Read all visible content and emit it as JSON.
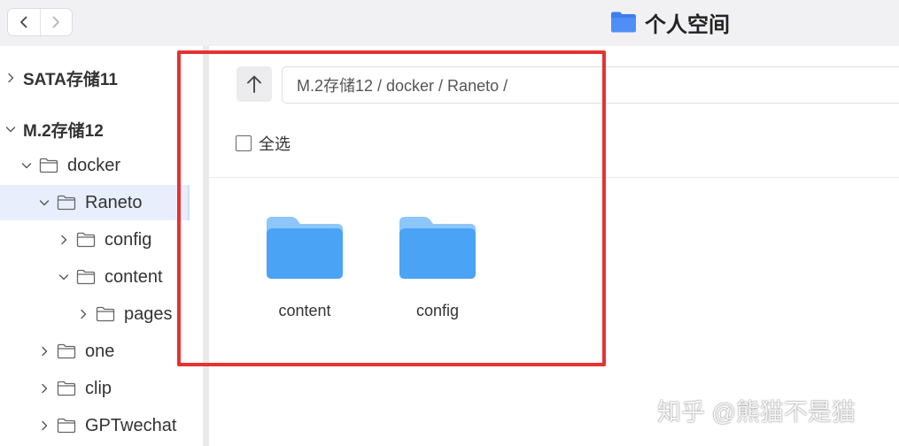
{
  "header": {
    "title": "个人空间",
    "back_icon": "chevron-left-icon",
    "forward_icon": "chevron-right-icon"
  },
  "sidebar": {
    "items": [
      {
        "label": "SATA存储11",
        "expanded": false
      },
      {
        "label": "M.2存储12",
        "expanded": true
      },
      {
        "label": "docker",
        "expanded": true
      },
      {
        "label": "Raneto",
        "expanded": true,
        "selected": true
      },
      {
        "label": "config",
        "expanded": false
      },
      {
        "label": "content",
        "expanded": true
      },
      {
        "label": "pages",
        "expanded": false
      },
      {
        "label": "one",
        "expanded": false
      },
      {
        "label": "clip",
        "expanded": false
      },
      {
        "label": "GPTwechat",
        "expanded": false
      }
    ]
  },
  "main": {
    "path": "M.2存储12 / docker / Raneto /",
    "select_all_label": "全选",
    "select_all_checked": false,
    "files": [
      {
        "name": "content",
        "icon": "folder-icon"
      },
      {
        "name": "config",
        "icon": "folder-icon"
      }
    ]
  },
  "watermark": "知乎 @熊猫不是猫",
  "colors": {
    "folder_blue": "#4aa3f5",
    "folder_light": "#8cc6fb",
    "highlight_red": "#e53232",
    "selected_bg": "#e8eefb",
    "title_folder": "#3d7ff0"
  }
}
